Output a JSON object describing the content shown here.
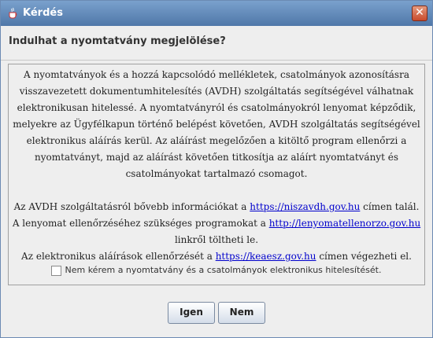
{
  "window": {
    "title": "Kérdés",
    "close_glyph": "✕"
  },
  "question": "Indulhat a nyomtatvány megjelölése?",
  "message": {
    "paragraph1": [
      "A nyomtatványok és a hozzá kapcsolódó mellékletek, csatolmányok azonosításra",
      "visszavezetett dokumentumhitelesítés (AVDH) szolgáltatás segítségével válhatnak",
      "elektronikusan hitelessé. A nyomtatványról és csatolmányokról lenyomat képződik,",
      "melyekre az Ügyfélkapun történő belépést követően, AVDH szolgáltatás segítségével",
      "elektronikus aláírás kerül. Az aláírást megelőzően a kitöltő program ellenőrzi a",
      "nyomtatványt, majd az aláírást követően titkosítja az aláírt nyomtatványt és",
      "csatolmányokat tartalmazó csomagot."
    ],
    "line_avdh": {
      "before": "Az AVDH szolgáltatásról bővebb információkat a ",
      "link": "https://niszavdh.gov.hu",
      "after": " címen talál."
    },
    "line_lenyomat": {
      "before": "A lenyomat ellenőrzéséhez szükséges programokat a ",
      "link": "http://lenyomatellenorzo.gov.hu",
      "after": ""
    },
    "line_lenyomat2": "linkről töltheti le.",
    "line_keaesz": {
      "before": "Az elektronikus aláírások ellenőrzését a ",
      "link": "https://keaesz.gov.hu",
      "after": " címen végezheti el."
    }
  },
  "checkbox": {
    "label": "Nem kérem a nyomtatvány és a csatolmányok elektronikus hitelesítését.",
    "checked": false
  },
  "buttons": {
    "yes": "Igen",
    "no": "Nem"
  },
  "colors": {
    "titlebar": "#5b82b3",
    "link": "#0000cc"
  },
  "icons": {
    "app": "java-cup-icon",
    "close": "close-icon"
  }
}
